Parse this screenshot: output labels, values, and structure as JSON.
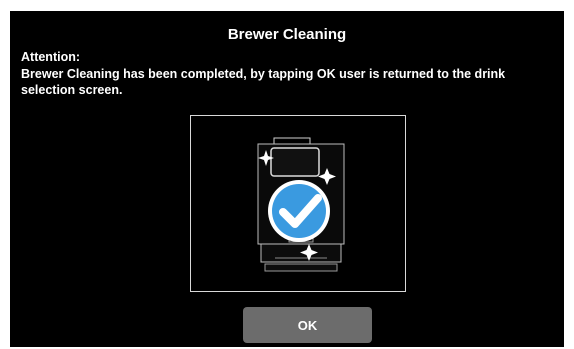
{
  "dialog": {
    "title": "Brewer Cleaning",
    "attention_label": "Attention:",
    "message": "Brewer Cleaning has been completed, by tapping OK user is returned to the drink selection screen.",
    "ok_label": "OK"
  },
  "illustration": {
    "icons": [
      "coffee-machine-icon",
      "checkmark-icon",
      "sparkle-icon"
    ],
    "colors": {
      "screen_background": "#000000",
      "check_circle": "#3a9ae0",
      "button": "#6c6c6c",
      "text": "#ffffff"
    }
  }
}
